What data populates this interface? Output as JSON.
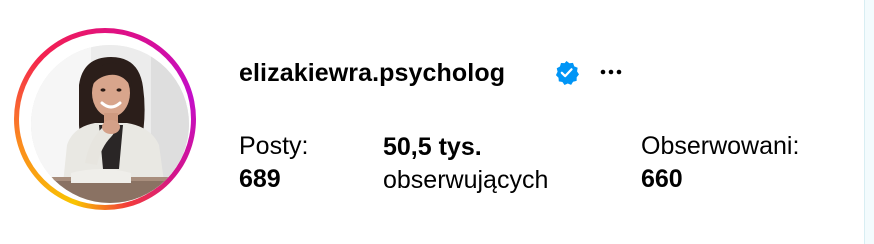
{
  "profile": {
    "username": "elizakiewra.psycholog",
    "verified": true,
    "more_icon": "more-horizontal-icon"
  },
  "stats": {
    "posts": {
      "label": "Posty:",
      "value": "689"
    },
    "followers": {
      "value": "50,5 tys.",
      "label": "obserwujących"
    },
    "following": {
      "label": "Obserwowani:",
      "value": "660"
    }
  },
  "colors": {
    "verified_badge": "#0095f6",
    "ring_start": "#f9c400",
    "ring_mid": "#f4214f",
    "ring_end": "#c40ec9"
  }
}
